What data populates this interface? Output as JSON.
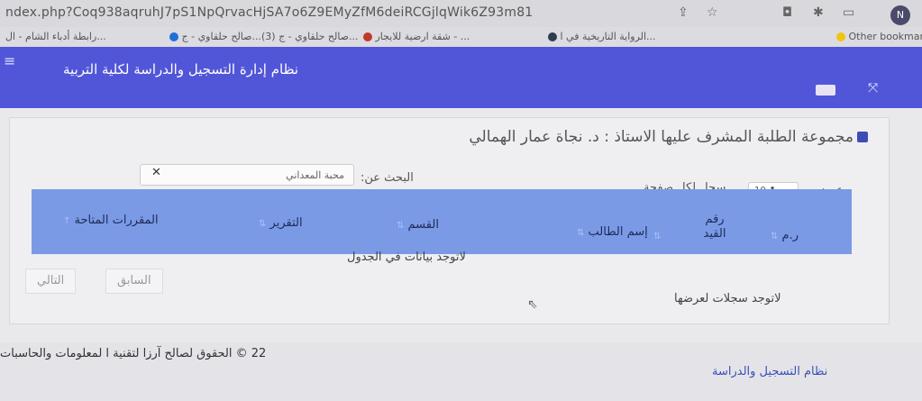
{
  "browser": {
    "url": "ndex.php?Coq938aqruhJ7pS1NpQrvacHjSA7o6Z9EMyZfM6deiRCGjlqWik6Z93m81",
    "bookmarks": [
      {
        "label": "رابطة أدباء الشام - ال...",
        "color": "#888888"
      },
      {
        "label": "صالح حلقاوي - ج...",
        "color": "#1e6fd9"
      },
      {
        "label": "(3) صالح حلقاوي - ج...",
        "color": "#888888"
      },
      {
        "label": "شقة ارضية للايجار - ...",
        "color": "#c0392b"
      },
      {
        "label": "الرواية التاريخية في ا...",
        "color": "#2c3e50"
      },
      {
        "label": "Other bookmarks",
        "color": "#f1c40f"
      }
    ],
    "profile_initial": "N"
  },
  "header": {
    "title": "نظام إدارة التسجيل والدراسة لكلية التربية"
  },
  "panel": {
    "title": "مجموعة الطلبة المشرف عليها الاستاذ : د. نجاة عمار الهمالي",
    "search_label": "البحث عن:",
    "search_value": "محبة المعداني",
    "show_label": "عرض",
    "page_size": "10",
    "per_page_label": "سجل لكل صفحة",
    "columns": [
      {
        "label": "ر.م"
      },
      {
        "label": "رقم القيد"
      },
      {
        "label": "إسم الطالب"
      },
      {
        "label": "القسم"
      },
      {
        "label": "التقرير"
      },
      {
        "label": "المقررات المتاحة"
      }
    ],
    "no_data": "لاتوجد بيانات في الجدول",
    "prev": "السابق",
    "next": "التالي",
    "no_records": "لاتوجد سجلات لعرضها"
  },
  "footer": {
    "copyright": "22 © الحقوق لصالح آرزا لتقنية ا لمعلومات والحاسبات",
    "link": "نظام التسجيل والدراسة"
  }
}
